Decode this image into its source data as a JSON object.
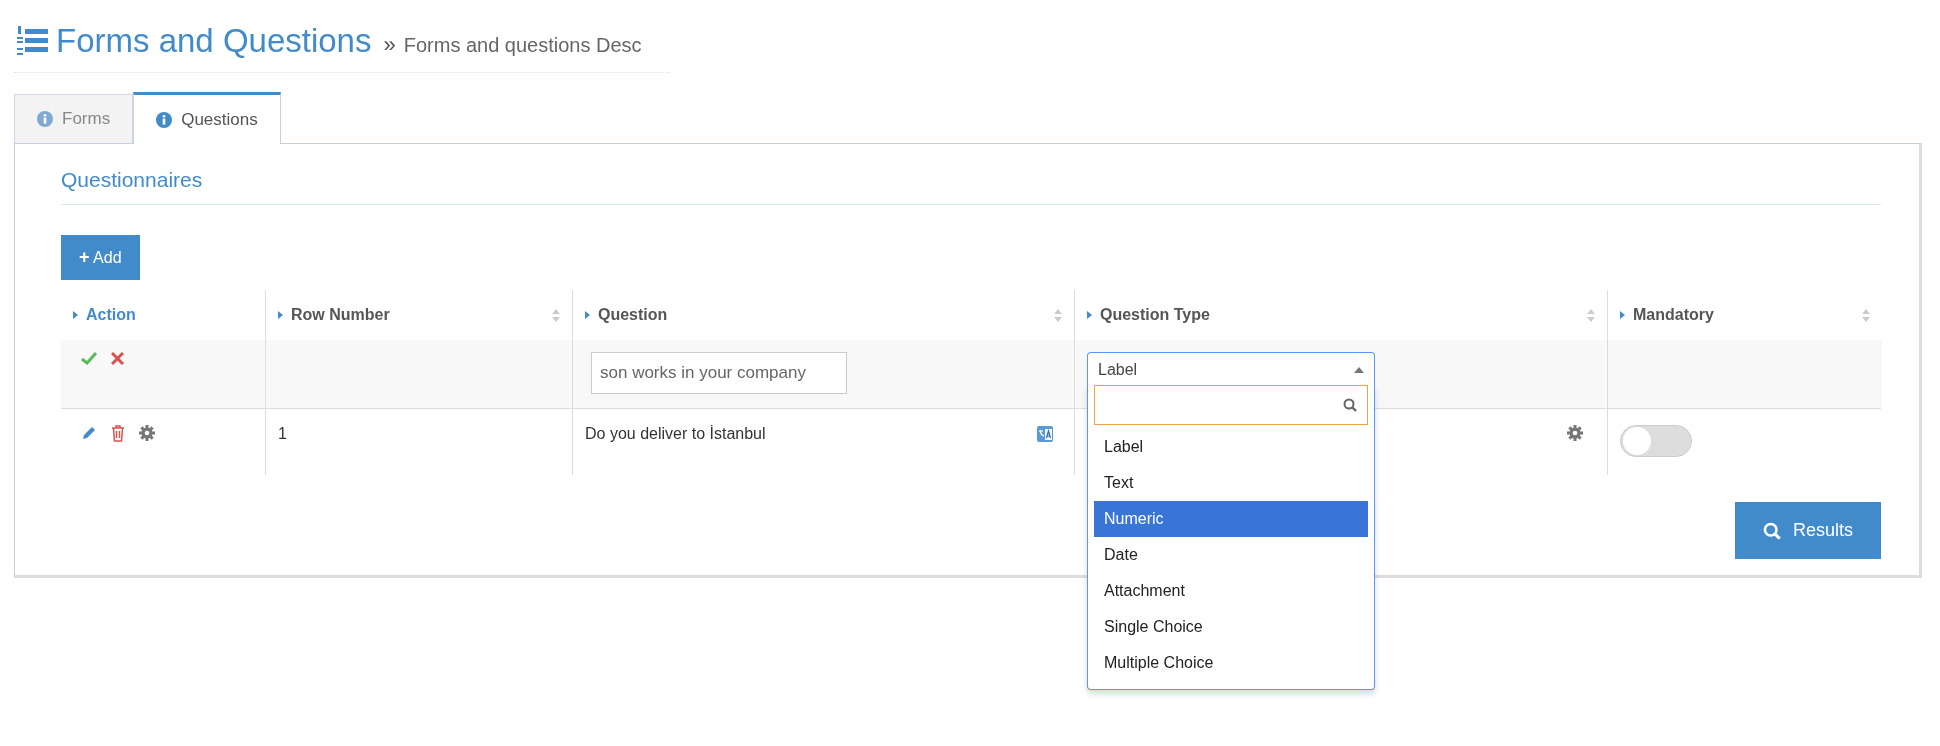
{
  "header": {
    "title": "Forms and Questions",
    "separator": "»",
    "subtitle": "Forms and questions Desc"
  },
  "tabs": [
    {
      "label": "Forms",
      "selected": false
    },
    {
      "label": "Questions",
      "selected": true
    }
  ],
  "section": {
    "title": "Questionnaires"
  },
  "add_button": {
    "icon": "+",
    "label": "Add"
  },
  "table": {
    "columns": [
      {
        "label": "Action",
        "kind": "action"
      },
      {
        "label": "Row Number",
        "kind": "sort"
      },
      {
        "label": "Question",
        "kind": "sort"
      },
      {
        "label": "Question Type",
        "kind": "sort"
      },
      {
        "label": "Mandatory",
        "kind": "sort"
      }
    ],
    "edit_row": {
      "question_value": "son works in your company",
      "type_value": "Label",
      "expanded": true,
      "options": [
        {
          "label": "Label",
          "selected": false
        },
        {
          "label": "Text",
          "selected": false
        },
        {
          "label": "Numeric",
          "selected": true
        },
        {
          "label": "Date",
          "selected": false
        },
        {
          "label": "Attachment",
          "selected": false
        },
        {
          "label": "Single Choice",
          "selected": false
        },
        {
          "label": "Multiple Choice",
          "selected": false
        }
      ]
    },
    "rows": [
      {
        "row_number": "1",
        "question": "Do you deliver to İstanbul",
        "mandatory": false
      }
    ]
  },
  "results_button": {
    "label": "Results"
  }
}
